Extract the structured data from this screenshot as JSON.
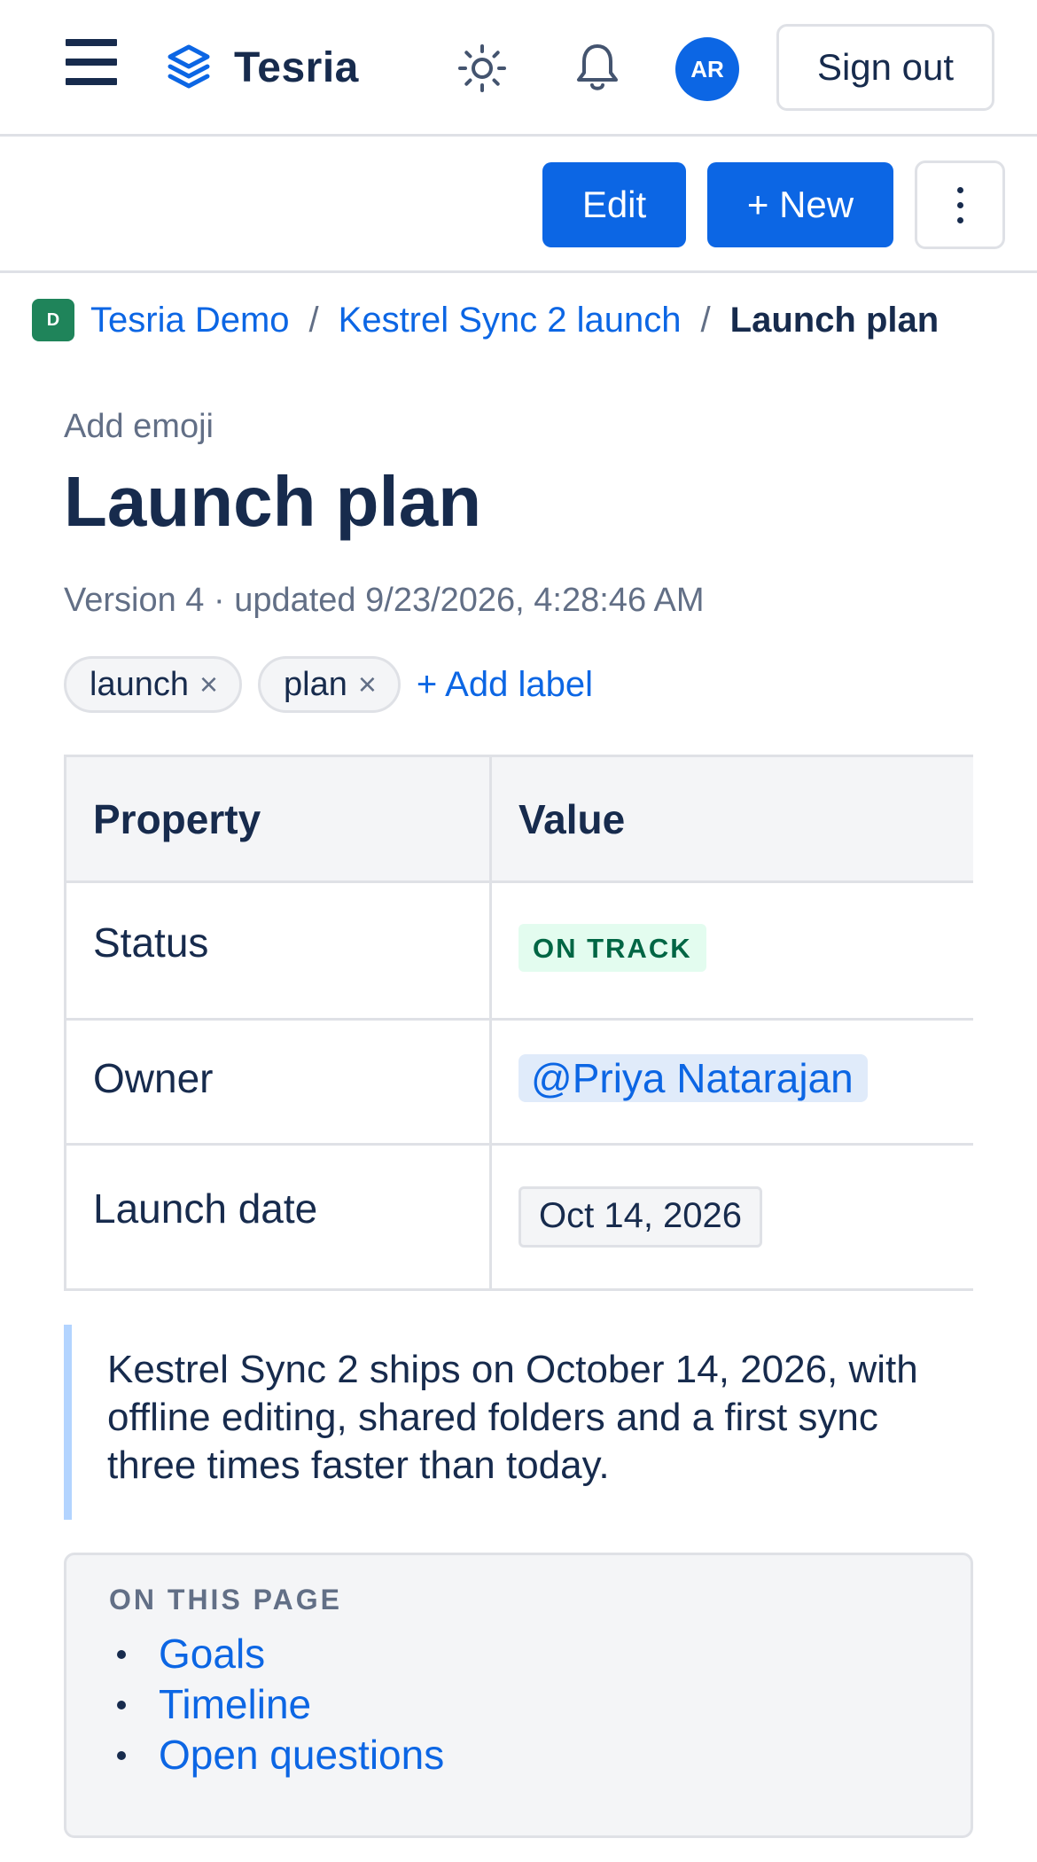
{
  "app": {
    "name": "Tesria",
    "avatar_initials": "AR",
    "sign_out_label": "Sign out",
    "brand_color": "#0c66e4"
  },
  "icons": {
    "menu": "hamburger-menu-icon",
    "logo": "stacked-layers-icon",
    "theme": "sun-icon",
    "notifications": "bell-icon",
    "more": "vertical-ellipsis-icon"
  },
  "toolbar": {
    "edit_label": "Edit",
    "new_label": "+ New"
  },
  "breadcrumb": {
    "space_badge": "D",
    "space": "Tesria Demo",
    "parent": "Kestrel Sync 2 launch",
    "current": "Launch plan",
    "separator": "/"
  },
  "page": {
    "add_emoji_label": "Add emoji",
    "title": "Launch plan",
    "meta": "Version 4 · updated 9/23/2026, 4:28:46 AM",
    "labels": [
      "launch",
      "plan"
    ],
    "label_remove_glyph": "×",
    "add_label": "+ Add label"
  },
  "properties": {
    "headers": {
      "property": "Property",
      "value": "Value"
    },
    "status": {
      "name": "Status",
      "value": "ON TRACK",
      "color": "#006644",
      "background": "#e3fcef"
    },
    "owner": {
      "name": "Owner",
      "value": "@Priya Natarajan"
    },
    "launch_date": {
      "name": "Launch date",
      "value": "Oct 14, 2026"
    }
  },
  "quote": {
    "text": "Kestrel Sync 2 ships on October 14, 2026, with offline editing, shared folders and a first sync three times faster than today."
  },
  "toc": {
    "heading": "ON THIS PAGE",
    "items": [
      "Goals",
      "Timeline",
      "Open questions"
    ]
  }
}
